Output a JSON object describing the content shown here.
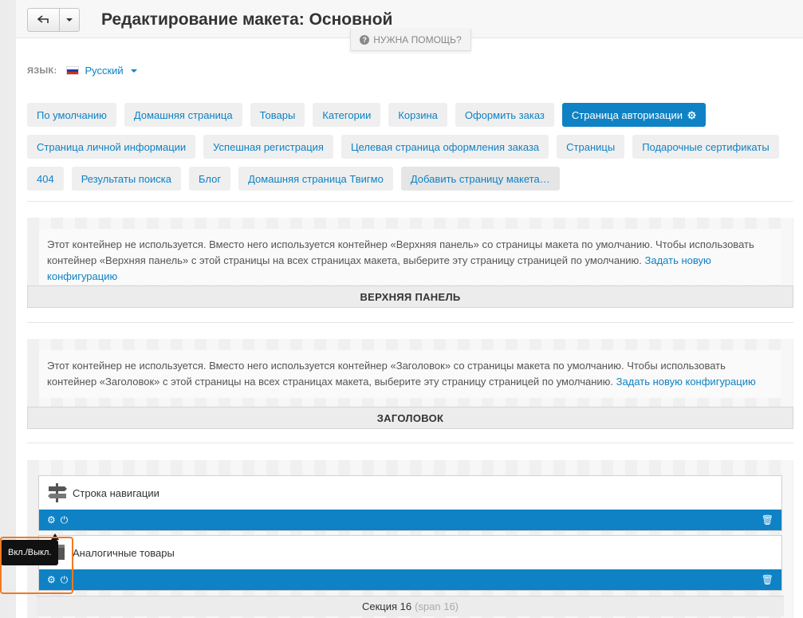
{
  "header": {
    "title": "Редактирование макета: Основной",
    "help": "НУЖНА ПОМОЩЬ?"
  },
  "language": {
    "label": "ЯЗЫК:",
    "selected": "Русский"
  },
  "tabs": [
    {
      "label": "По умолчанию"
    },
    {
      "label": "Домашняя страница"
    },
    {
      "label": "Товары"
    },
    {
      "label": "Категории"
    },
    {
      "label": "Корзина"
    },
    {
      "label": "Оформить заказ"
    },
    {
      "label": "Страница авторизации",
      "active": true
    },
    {
      "label": "Страница личной информации"
    },
    {
      "label": "Успешная регистрация"
    },
    {
      "label": "Целевая страница оформления заказа"
    },
    {
      "label": "Страницы"
    },
    {
      "label": "Подарочные сертификаты"
    },
    {
      "label": "404"
    },
    {
      "label": "Результаты поиска"
    },
    {
      "label": "Блог"
    },
    {
      "label": "Домашняя страница Твигмо"
    },
    {
      "label": "Добавить страницу макета…"
    }
  ],
  "containers": {
    "top_panel": {
      "notice": "Этот контейнер не используется. Вместо него используется контейнер «Верхняя панель» со страницы макета по умолчанию. Чтобы использовать контейнер «Верхняя панель» с этой страницы на всех страницах макета, выберите эту страницу страницей по умолчанию.",
      "link": "Задать новую конфигурацию",
      "title": "ВЕРХНЯЯ ПАНЕЛЬ"
    },
    "header": {
      "notice": "Этот контейнер не используется. Вместо него используется контейнер «Заголовок» со страницы макета по умолчанию. Чтобы использовать контейнер «Заголовок» с этой страницы на всех страницах макета, выберите эту страницу страницей по умолчанию.",
      "link": "Задать новую конфигурацию",
      "title": "ЗАГОЛОВОК"
    }
  },
  "blocks": [
    {
      "name": "Строка навигации",
      "icon": "signpost-icon"
    },
    {
      "name": "Аналогичные товары",
      "icon": "box-icon"
    }
  ],
  "section": {
    "name": "Секция 16",
    "span": "(span 16)"
  },
  "tooltip": "Вкл./Выкл.",
  "colors": {
    "accent": "#0e82c5",
    "highlight": "#f07a22"
  }
}
